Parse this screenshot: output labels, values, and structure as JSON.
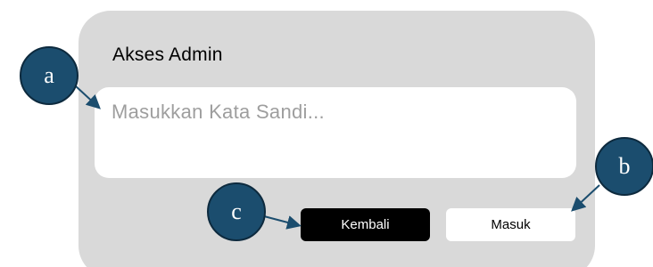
{
  "dialog": {
    "title": "Akses Admin",
    "password_placeholder": "Masukkan Kata Sandi...",
    "back_label": "Kembali",
    "submit_label": "Masuk"
  },
  "markers": {
    "a": "a",
    "b": "b",
    "c": "c"
  },
  "colors": {
    "dialog_bg": "#d9d9d9",
    "input_bg": "#ffffff",
    "back_button_bg": "#000000",
    "submit_button_bg": "#ffffff",
    "marker_fill": "#1b4d6e",
    "marker_arrow": "#1b4d6e"
  }
}
